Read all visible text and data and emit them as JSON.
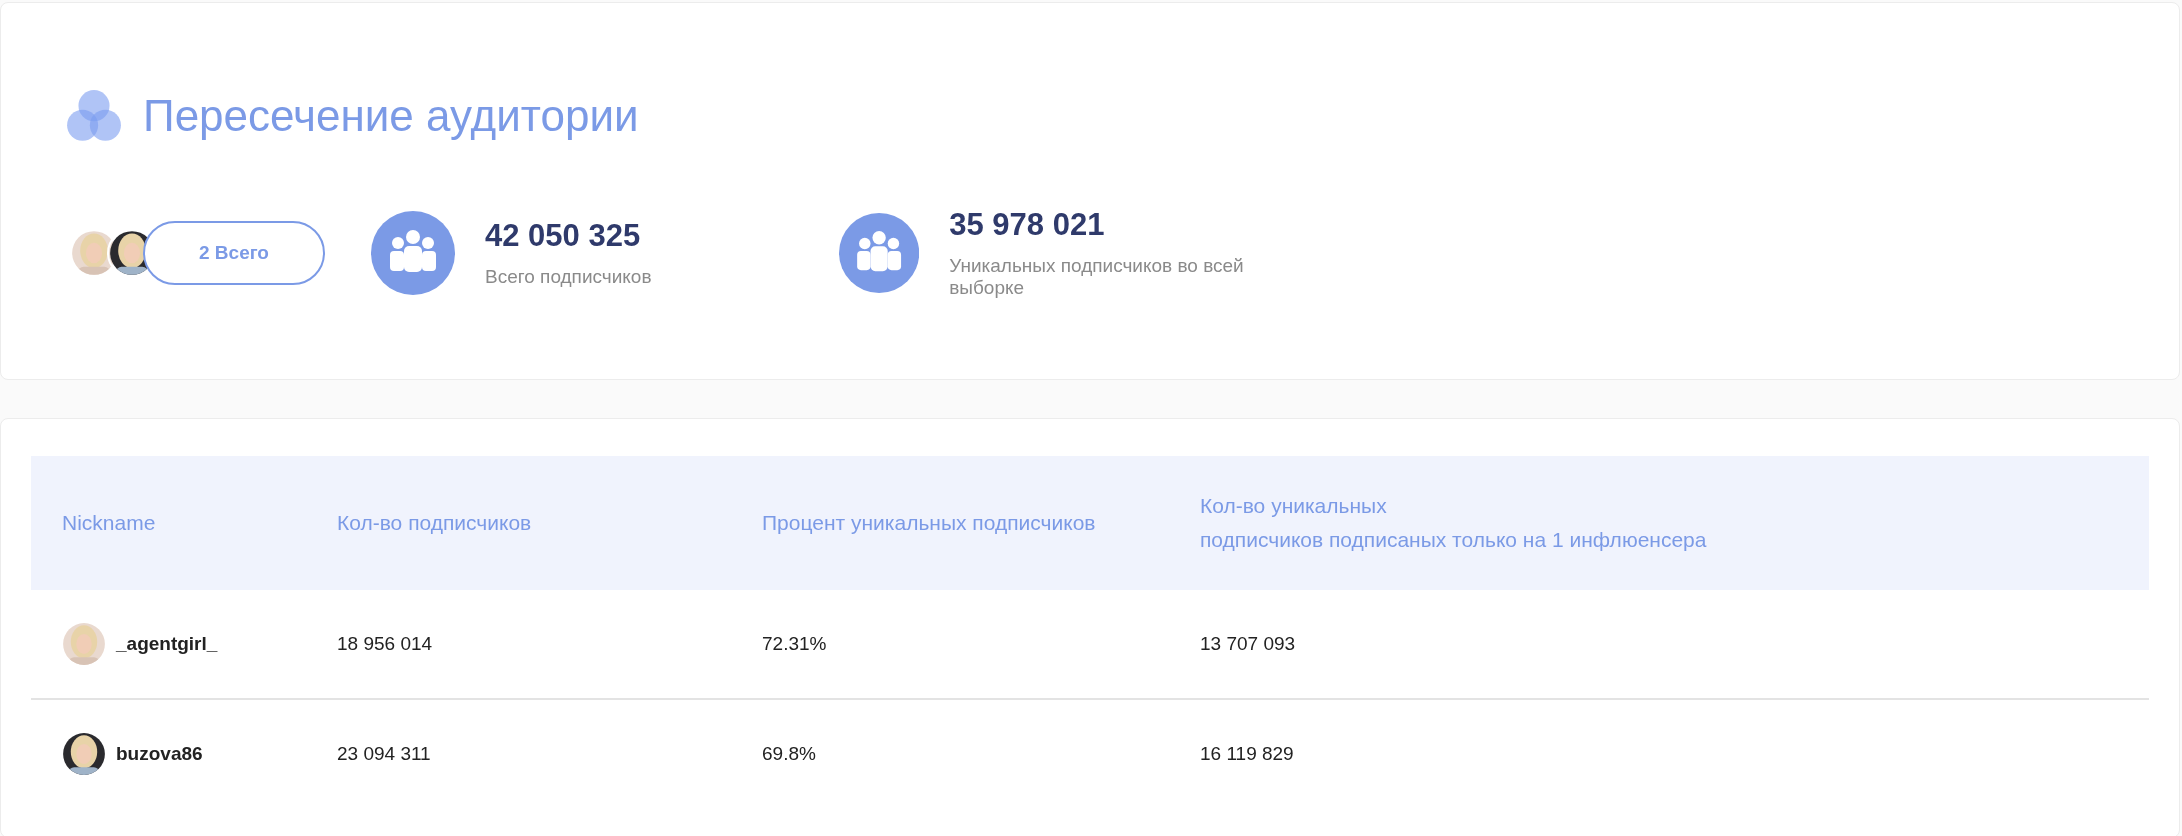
{
  "header": {
    "title": "Пересечение аудитории",
    "total_button": "2 Всего",
    "stats": [
      {
        "value": "42 050 325",
        "label": "Всего подписчиков"
      },
      {
        "value": "35 978 021",
        "label": "Уникальных подписчиков во всей выборке"
      }
    ]
  },
  "table": {
    "columns": [
      "Nickname",
      "Кол-во подписчиков",
      "Процент уникальных подписчиков",
      "Кол-во уникальных\nподписчиков подписаных только на 1 инфлюенсера"
    ],
    "rows": [
      {
        "nickname": "_agentgirl_",
        "followers": "18 956 014",
        "unique_percent": "72.31%",
        "unique_only_one": "13 707 093"
      },
      {
        "nickname": "buzova86",
        "followers": "23 094 311",
        "unique_percent": "69.8%",
        "unique_only_one": "16 119 829"
      }
    ]
  }
}
